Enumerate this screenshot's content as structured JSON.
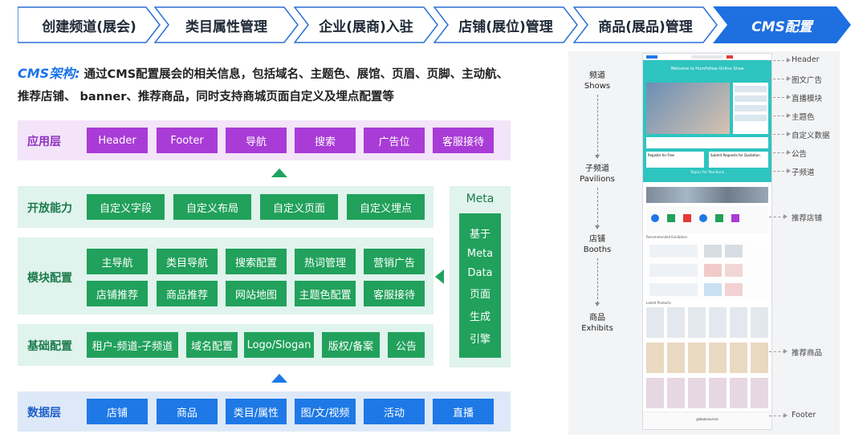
{
  "steps": [
    {
      "label": "创建频道(展会)"
    },
    {
      "label": "类目属性管理"
    },
    {
      "label": "企业(展商)入驻"
    },
    {
      "label": "店铺(展位)管理"
    },
    {
      "label": "商品(展品)管理"
    },
    {
      "label": "CMS配置"
    }
  ],
  "description": {
    "lead": "CMS架构:",
    "line1": " 通过CMS配置展会的相关信息，包括域名、主题色、展馆、页眉、页脚、主动航、",
    "line2": "推荐店铺、 banner、推荐商品，同时支持商城页面自定义及埋点配置等"
  },
  "layers": {
    "app": {
      "label": "应用层",
      "items": [
        "Header",
        "Footer",
        "导航",
        "搜索",
        "广告位",
        "客服接待"
      ]
    },
    "open": {
      "label": "开放能力",
      "items": [
        "自定义字段",
        "自定义布局",
        "自定义页面",
        "自定义埋点"
      ]
    },
    "module": {
      "label": "模块配置",
      "row1": [
        "主导航",
        "类目导航",
        "搜索配置",
        "热词管理",
        "营销广告"
      ],
      "row2": [
        "店铺推荐",
        "商品推荐",
        "网站地图",
        "主题色配置",
        "客服接待"
      ]
    },
    "base": {
      "label": "基础配置",
      "items": [
        "租户-频道-子频道",
        "域名配置",
        "Logo/Slogan",
        "版权/备案",
        "公告"
      ]
    },
    "data": {
      "label": "数据层",
      "items": [
        "店铺",
        "商品",
        "类目/属性",
        "图/文/视频",
        "活动",
        "直播"
      ]
    }
  },
  "meta": {
    "title": "Meta",
    "chars": [
      "基于",
      "Meta",
      "Data",
      "页面",
      "生成",
      "引擎"
    ]
  },
  "flow": [
    {
      "cn": "频道",
      "en": "Shows"
    },
    {
      "cn": "子频道",
      "en": "Pavilions"
    },
    {
      "cn": "店铺",
      "en": "Booths"
    },
    {
      "cn": "商品",
      "en": "Exhibits"
    }
  ],
  "annotations": [
    "Header",
    "图文广告",
    "直播模块",
    "主题色",
    "自定义数据",
    "公告",
    "子频道",
    "推荐店铺",
    "推荐商品",
    "Footer"
  ],
  "mock_page": {
    "hero_text": "Welcome to HumFellow Online Show",
    "section_title": "Topics for Pavilions",
    "card1": "Register for Free",
    "card2": "Submit Requests for Quotation",
    "rec_label": "Recommended Exhibitors",
    "latest_label": "Latest Products",
    "footer_text": "globalsources"
  },
  "colors": {
    "active_step": "#1e6fe0",
    "green": "#21a15b",
    "purple": "#a93bd7",
    "blue": "#1e78e6",
    "teal": "#2ec4c0"
  }
}
